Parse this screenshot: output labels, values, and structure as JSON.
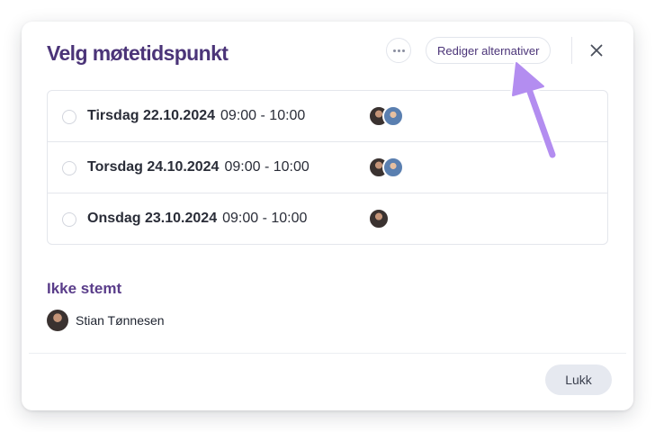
{
  "dialog": {
    "title": "Velg møtetidspunkt",
    "edit_label": "Rediger alternativer",
    "more_icon": "more-horizontal-icon",
    "close_icon": "close-icon"
  },
  "options": [
    {
      "date": "Tirsdag 22.10.2024",
      "time": "09:00 - 10:00",
      "voters": 2
    },
    {
      "date": "Torsdag 24.10.2024",
      "time": "09:00 - 10:00",
      "voters": 2
    },
    {
      "date": "Onsdag 23.10.2024",
      "time": "09:00 - 10:00",
      "voters": 1
    }
  ],
  "not_voted": {
    "title": "Ikke stemt",
    "people": [
      {
        "name": "Stian Tønnesen"
      }
    ]
  },
  "footer": {
    "close_label": "Lukk"
  },
  "colors": {
    "title": "#4b3478",
    "section_title": "#5a3d8a",
    "arrow": "#b38df0",
    "button_bg": "#e6e9f0"
  }
}
